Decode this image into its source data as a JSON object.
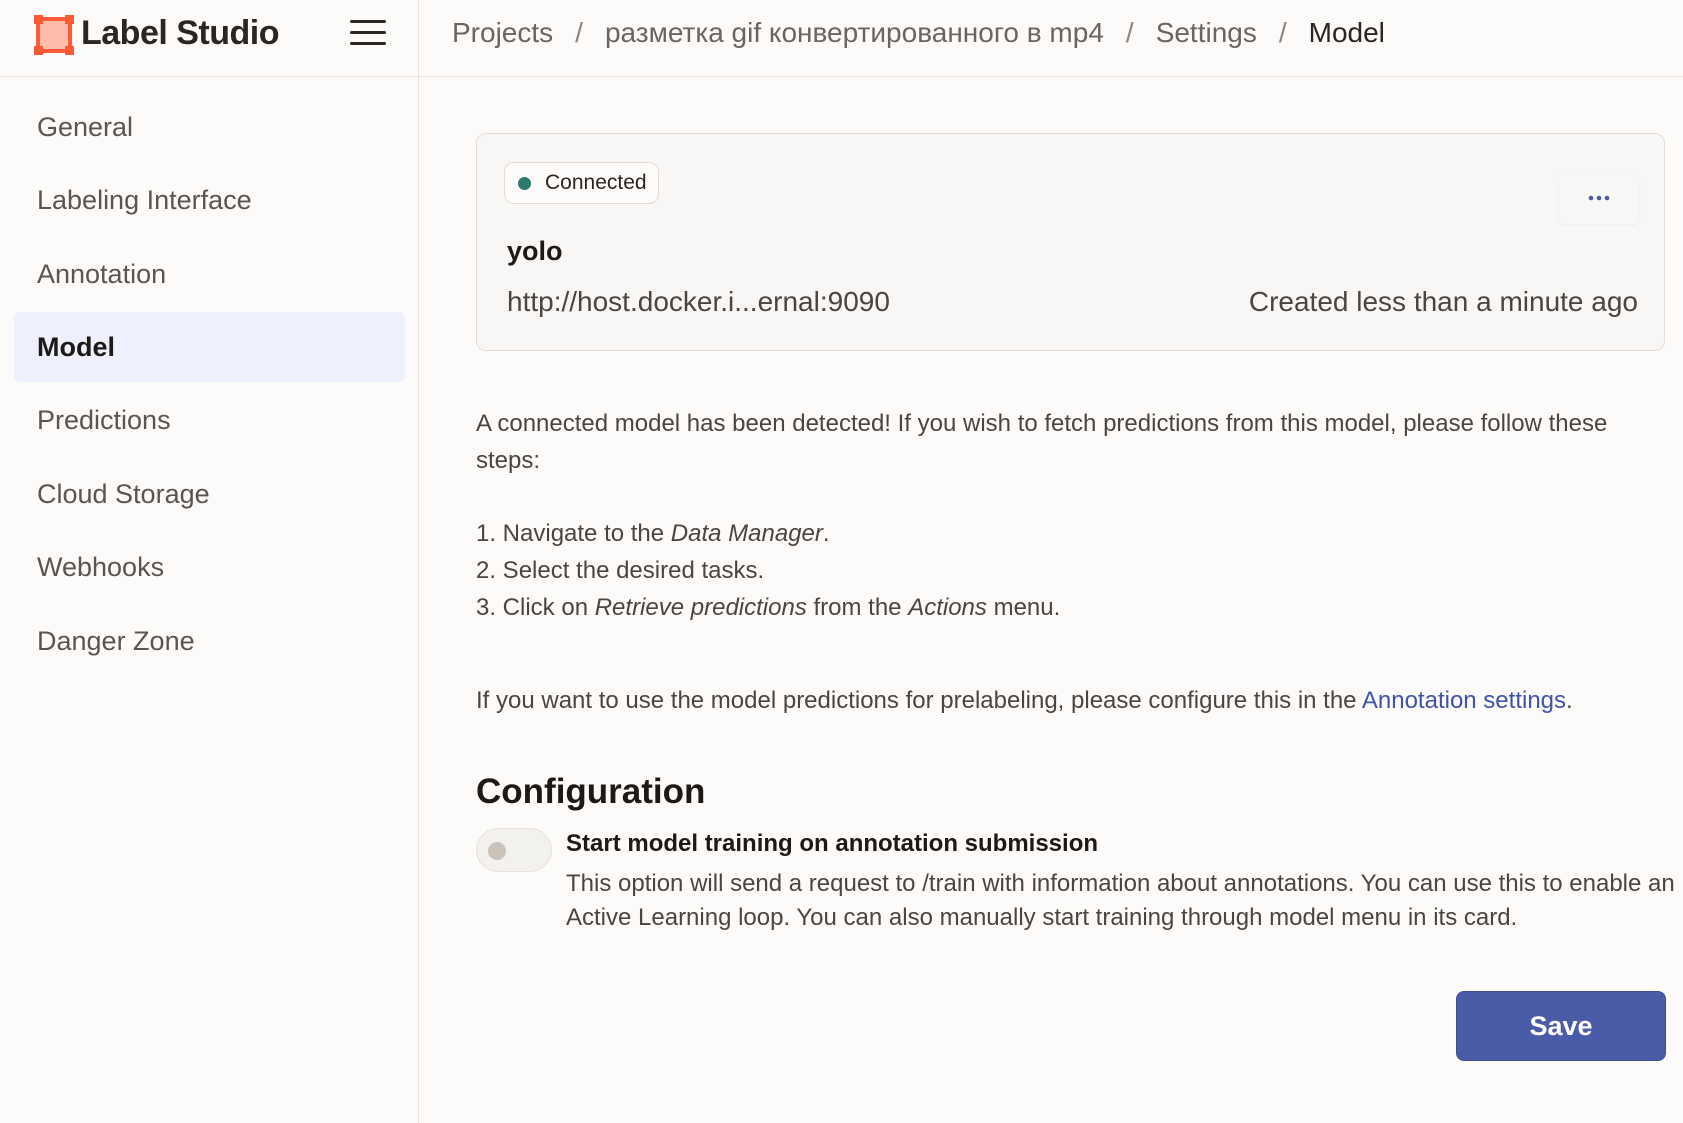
{
  "app": {
    "name": "Label Studio",
    "brand_color": "#ff6a45"
  },
  "breadcrumb": {
    "items": [
      "Projects",
      "разметка gif конвертированного в mp4",
      "Settings"
    ],
    "separator": "/",
    "current": "Model"
  },
  "sidebar": {
    "items": [
      {
        "label": "General"
      },
      {
        "label": "Labeling Interface"
      },
      {
        "label": "Annotation"
      },
      {
        "label": "Model",
        "active": true
      },
      {
        "label": "Predictions"
      },
      {
        "label": "Cloud Storage"
      },
      {
        "label": "Webhooks"
      },
      {
        "label": "Danger Zone"
      }
    ]
  },
  "model_card": {
    "status": "Connected",
    "status_color": "#2b7a6b",
    "more_icon": "ellipsis-icon",
    "name": "yolo",
    "url": "http://host.docker.i...ernal:9090",
    "created": "Created less than a minute ago"
  },
  "instructions": {
    "intro": "A connected model has been detected! If you wish to fetch predictions from this model, please follow these steps:",
    "step1_prefix": "1. Navigate to the ",
    "step1_em": "Data Manager",
    "step1_suffix": ".",
    "step2": "2. Select the desired tasks.",
    "step3_prefix": "3. Click on ",
    "step3_em1": "Retrieve predictions",
    "step3_mid": " from the ",
    "step3_em2": "Actions",
    "step3_suffix": " menu.",
    "prelabel_prefix": "If you want to use the model predictions for prelabeling, please configure this in the ",
    "prelabel_link": "Annotation settings",
    "prelabel_suffix": "."
  },
  "configuration": {
    "title": "Configuration",
    "toggle_label": "Start model training on annotation submission",
    "toggle_enabled": false,
    "toggle_description": "This option will send a request to /train with information about annotations. You can use this to enable an Active Learning loop. You can also manually start training through model menu in its card."
  },
  "actions": {
    "save_label": "Save",
    "save_color": "#4a5ba8"
  }
}
